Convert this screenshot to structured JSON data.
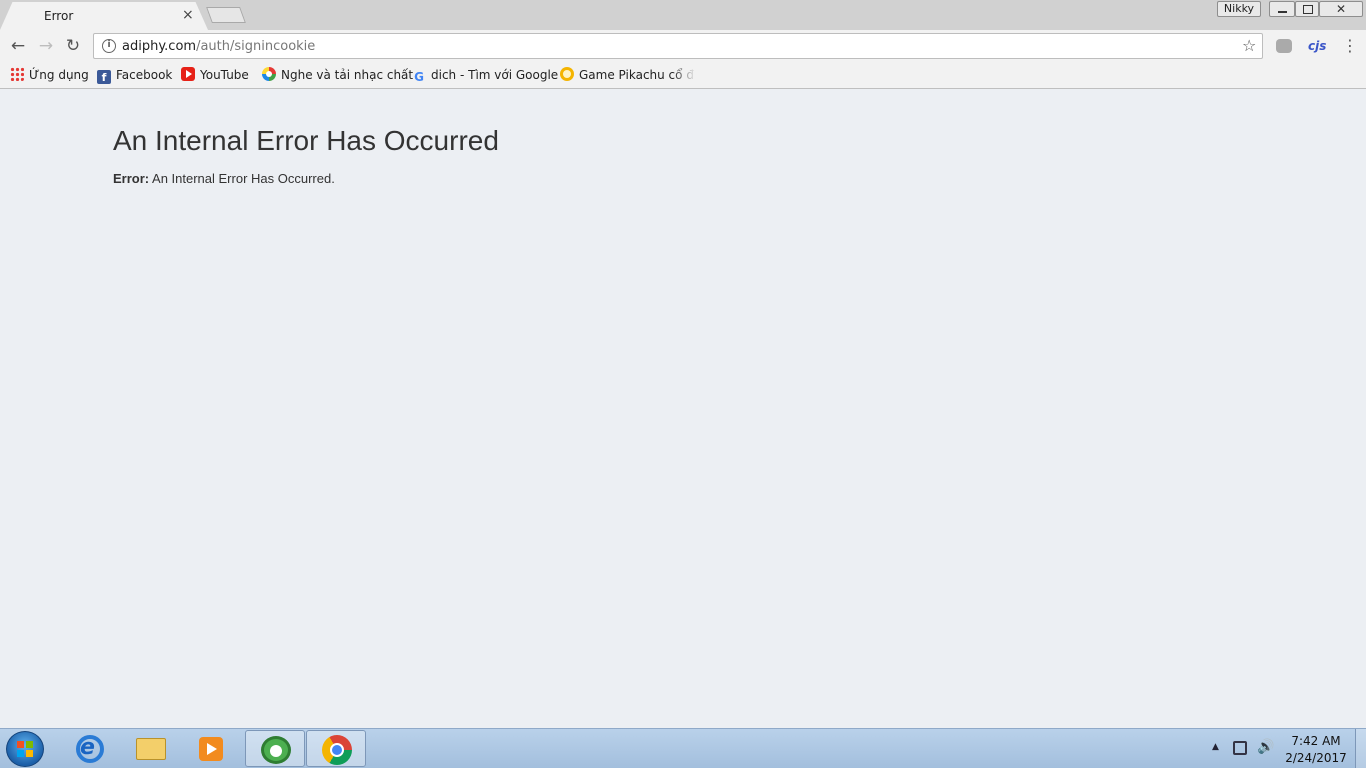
{
  "tab": {
    "title": "Error",
    "close": "×"
  },
  "window": {
    "user": "Nikky",
    "close": "✕"
  },
  "toolbar": {
    "url_host": "adiphy.com",
    "url_path": "/auth/signincookie",
    "ext_label": "cjs"
  },
  "bookmarks": [
    {
      "label": "Ứng dụng",
      "icon": "apps-grid-icon"
    },
    {
      "label": "Facebook",
      "icon": "facebook-icon"
    },
    {
      "label": "YouTube",
      "icon": "youtube-icon"
    },
    {
      "label": "Nghe và tải nhạc chất",
      "icon": "nhaccuatui-icon"
    },
    {
      "label": "dich - Tìm với Google",
      "icon": "google-icon"
    },
    {
      "label": "Game Pikachu cổ điển",
      "icon": "pikachu-icon"
    }
  ],
  "page": {
    "title": "An Internal Error Has Occurred",
    "error_label": "Error:",
    "error_message": " An Internal Error Has Occurred."
  },
  "taskbar": {
    "time": "7:42 AM",
    "date": "2/24/2017"
  }
}
